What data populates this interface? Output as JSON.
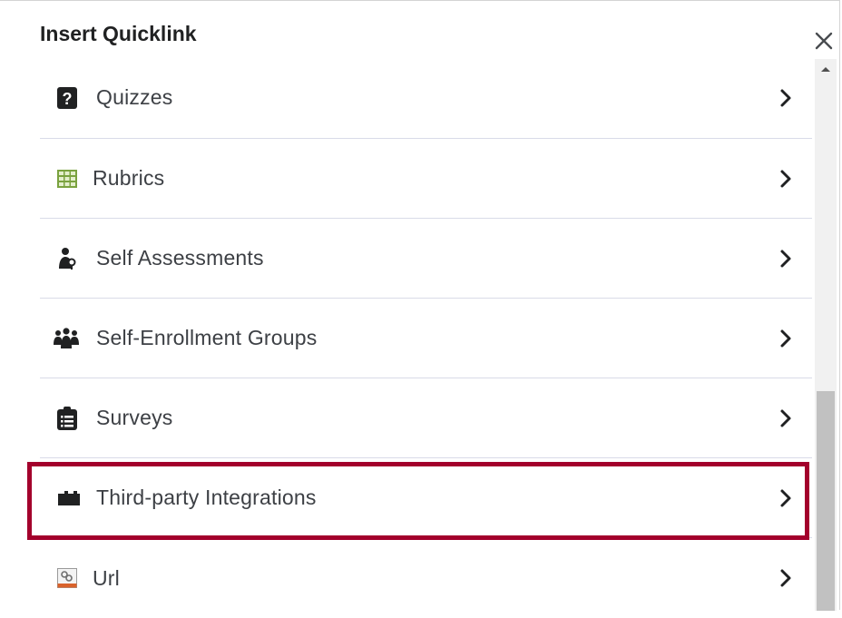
{
  "dialog": {
    "title": "Insert Quicklink"
  },
  "items": [
    {
      "label": "Quizzes",
      "icon": "quiz-icon"
    },
    {
      "label": "Rubrics",
      "icon": "rubric-icon"
    },
    {
      "label": "Self Assessments",
      "icon": "self-assessment-icon"
    },
    {
      "label": "Self-Enrollment Groups",
      "icon": "groups-icon"
    },
    {
      "label": "Surveys",
      "icon": "survey-icon"
    },
    {
      "label": "Third-party Integrations",
      "icon": "puzzle-icon"
    },
    {
      "label": "Url",
      "icon": "url-icon"
    }
  ],
  "colors": {
    "highlight": "#a3002c",
    "text": "#3d4045",
    "divider": "#d9dbe8"
  }
}
